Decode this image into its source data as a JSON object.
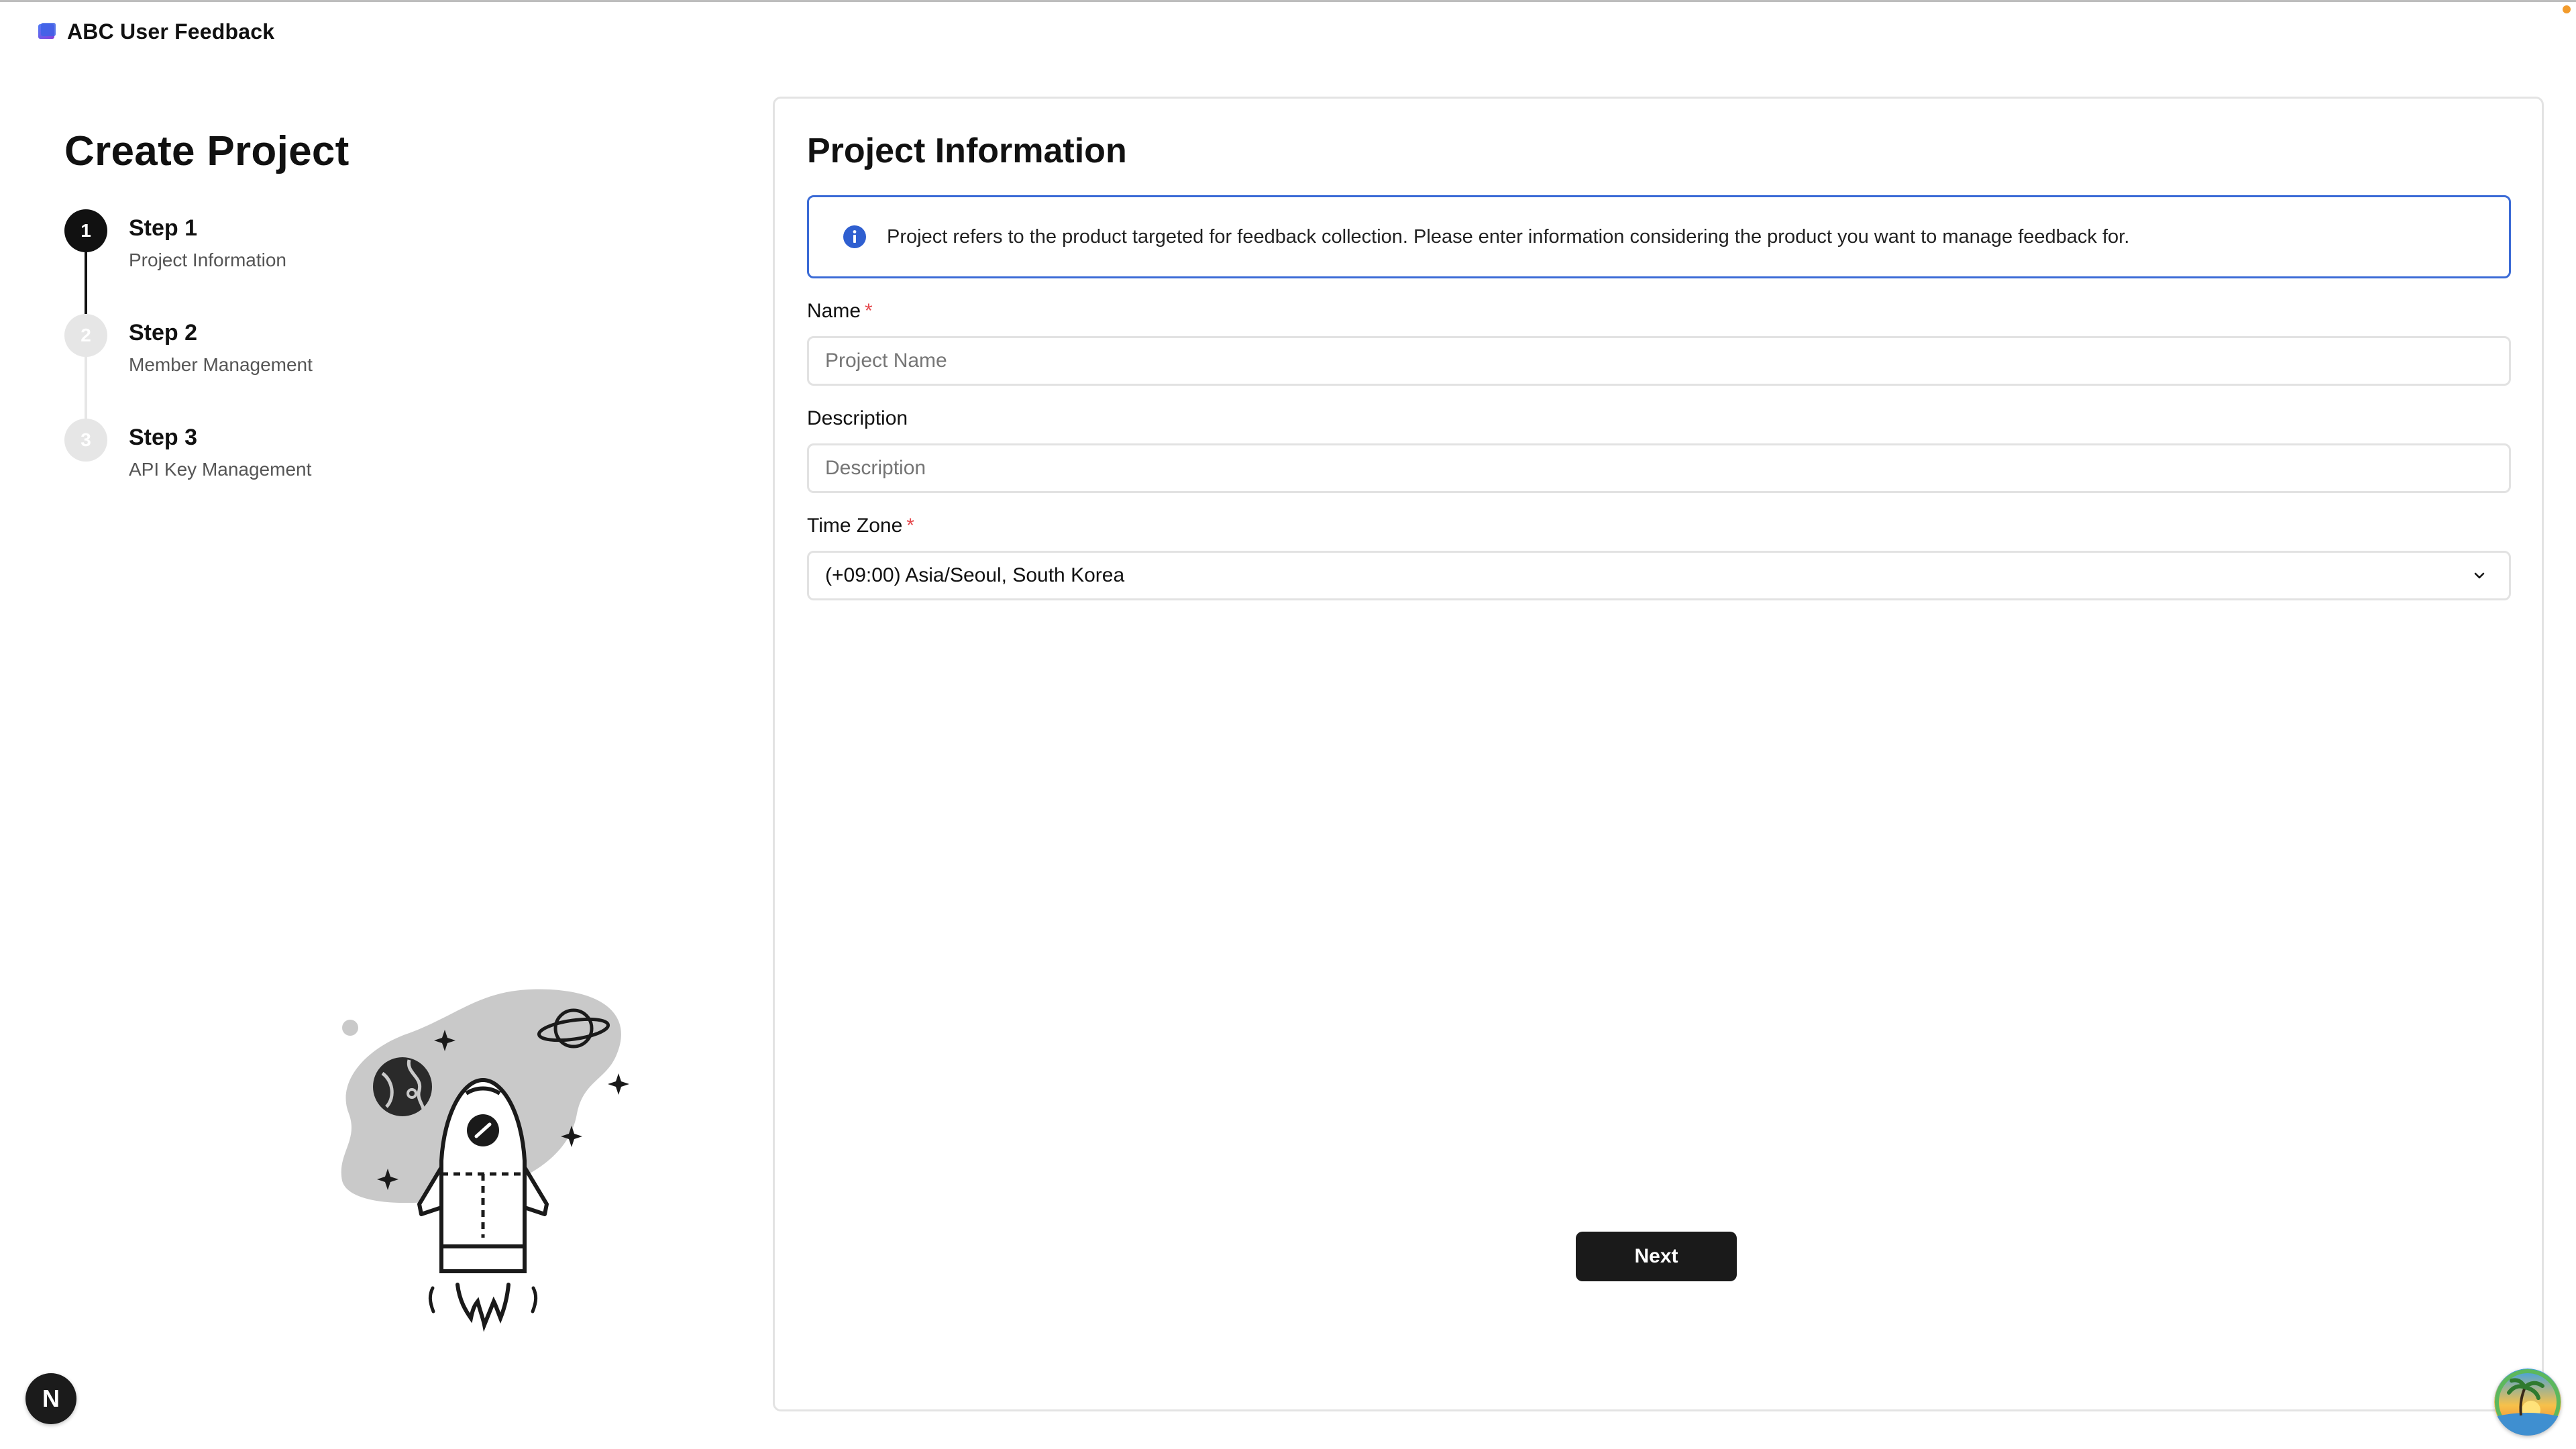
{
  "app": {
    "name": "ABC User Feedback"
  },
  "left": {
    "title": "Create Project",
    "steps": [
      {
        "number": "1",
        "title": "Step 1",
        "subtitle": "Project Information",
        "state": "active"
      },
      {
        "number": "2",
        "title": "Step 2",
        "subtitle": "Member Management",
        "state": "inactive"
      },
      {
        "number": "3",
        "title": "Step 3",
        "subtitle": "API Key Management",
        "state": "inactive"
      }
    ]
  },
  "form": {
    "title": "Project Information",
    "info": "Project refers to the product targeted for feedback collection. Please enter information considering the product you want to manage feedback for.",
    "name": {
      "label": "Name",
      "required_mark": "*",
      "placeholder": "Project Name"
    },
    "description": {
      "label": "Description",
      "placeholder": "Description"
    },
    "timezone": {
      "label": "Time Zone",
      "required_mark": "*",
      "value": "(+09:00) Asia/Seoul, South Korea"
    },
    "next_label": "Next"
  },
  "badge": {
    "letter": "N"
  },
  "colors": {
    "primary": "#1a1a1a",
    "info_border": "#3b6bd6",
    "required": "#e5484d",
    "inactive_step": "#e6e6e6"
  },
  "icons": [
    "app-logo-icon",
    "info-icon",
    "chevron-down-icon",
    "rocket-illustration",
    "next-js-badge-icon",
    "user-avatar"
  ]
}
